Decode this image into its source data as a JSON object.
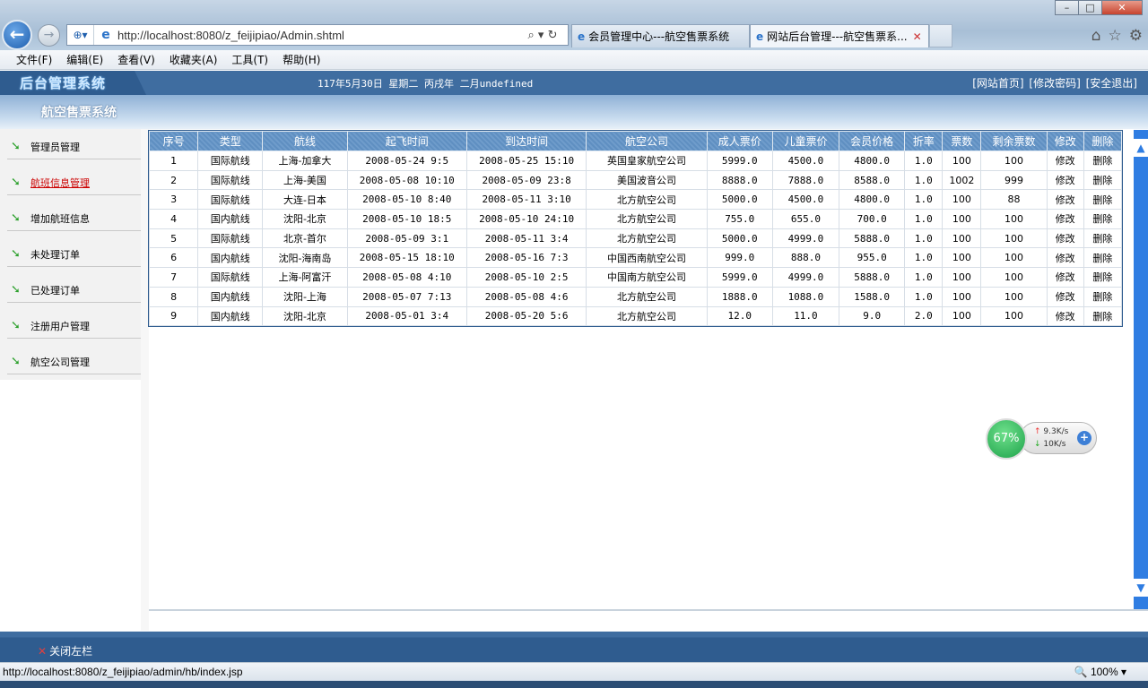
{
  "browser": {
    "url": "http://localhost:8080/z_feijipiao/Admin.shtml",
    "tabs": [
      {
        "label": "会员管理中心---航空售票系统"
      },
      {
        "label": "网站后台管理---航空售票系..."
      }
    ],
    "menu": [
      "文件(F)",
      "编辑(E)",
      "查看(V)",
      "收藏夹(A)",
      "工具(T)",
      "帮助(H)"
    ],
    "status_url": "http://localhost:8080/z_feijipiao/admin/hb/index.jsp",
    "zoom": "100%"
  },
  "header": {
    "logo": "后台管理系统",
    "date": "117年5月30日 星期二 丙戌年 二月undefined",
    "links": [
      "[网站首页]",
      "[修改密码]",
      "[安全退出]"
    ],
    "system_title": "航空售票系统"
  },
  "sidebar": {
    "items": [
      {
        "label": "管理员管理"
      },
      {
        "label": "航班信息管理"
      },
      {
        "label": "增加航班信息"
      },
      {
        "label": "未处理订单"
      },
      {
        "label": "已处理订单"
      },
      {
        "label": "注册用户管理"
      },
      {
        "label": "航空公司管理"
      }
    ],
    "active_index": 1,
    "close_label": "关闭左栏"
  },
  "table": {
    "headers": [
      "序号",
      "类型",
      "航线",
      "起飞时间",
      "到达时间",
      "航空公司",
      "成人票价",
      "儿童票价",
      "会员价格",
      "折率",
      "票数",
      "剩余票数",
      "修改",
      "删除"
    ],
    "rows": [
      [
        "1",
        "国际航线",
        "上海-加拿大",
        "2008-05-24 9:5",
        "2008-05-25 15:10",
        "英国皇家航空公司",
        "5999.0",
        "4500.0",
        "4800.0",
        "1.0",
        "100",
        "100",
        "修改",
        "删除"
      ],
      [
        "2",
        "国际航线",
        "上海-美国",
        "2008-05-08 10:10",
        "2008-05-09 23:8",
        "美国波音公司",
        "8888.0",
        "7888.0",
        "8588.0",
        "1.0",
        "1002",
        "999",
        "修改",
        "删除"
      ],
      [
        "3",
        "国际航线",
        "大连-日本",
        "2008-05-10 8:40",
        "2008-05-11 3:10",
        "北方航空公司",
        "5000.0",
        "4500.0",
        "4800.0",
        "1.0",
        "100",
        "88",
        "修改",
        "删除"
      ],
      [
        "4",
        "国内航线",
        "沈阳-北京",
        "2008-05-10 18:5",
        "2008-05-10 24:10",
        "北方航空公司",
        "755.0",
        "655.0",
        "700.0",
        "1.0",
        "100",
        "100",
        "修改",
        "删除"
      ],
      [
        "5",
        "国际航线",
        "北京-首尔",
        "2008-05-09 3:1",
        "2008-05-11 3:4",
        "北方航空公司",
        "5000.0",
        "4999.0",
        "5888.0",
        "1.0",
        "100",
        "100",
        "修改",
        "删除"
      ],
      [
        "6",
        "国内航线",
        "沈阳-海南岛",
        "2008-05-15 18:10",
        "2008-05-16 7:3",
        "中国西南航空公司",
        "999.0",
        "888.0",
        "955.0",
        "1.0",
        "100",
        "100",
        "修改",
        "删除"
      ],
      [
        "7",
        "国际航线",
        "上海-阿富汗",
        "2008-05-08 4:10",
        "2008-05-10 2:5",
        "中国南方航空公司",
        "5999.0",
        "4999.0",
        "5888.0",
        "1.0",
        "100",
        "100",
        "修改",
        "删除"
      ],
      [
        "8",
        "国内航线",
        "沈阳-上海",
        "2008-05-07 7:13",
        "2008-05-08 4:6",
        "北方航空公司",
        "1888.0",
        "1088.0",
        "1588.0",
        "1.0",
        "100",
        "100",
        "修改",
        "删除"
      ],
      [
        "9",
        "国内航线",
        "沈阳-北京",
        "2008-05-01 3:4",
        "2008-05-20 5:6",
        "北方航空公司",
        "12.0",
        "11.0",
        "9.0",
        "2.0",
        "100",
        "100",
        "修改",
        "删除"
      ]
    ]
  },
  "widget": {
    "percent": "67%",
    "up_rate": "9.3K/s",
    "down_rate": "10K/s"
  },
  "colors": {
    "header_bg": "#3f6da0",
    "table_header_bg": "#5f8fc1",
    "active_link": "#cc0000",
    "scrollbar": "#2f7de2"
  }
}
